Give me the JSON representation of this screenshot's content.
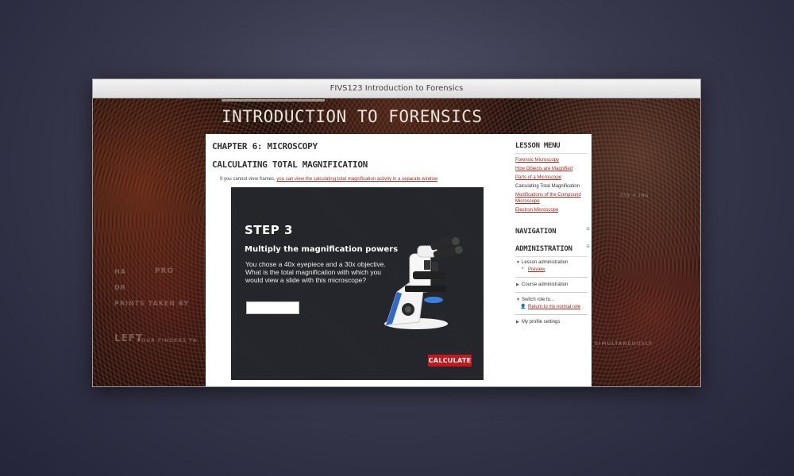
{
  "window": {
    "title": "FIVS123 Introduction to Forensics"
  },
  "banner": {
    "title": "INTRODUCTION TO FORENSICS"
  },
  "background_text": {
    "left_1": "HA",
    "left_2": "PRO",
    "left_3": "DR",
    "left_4": "PRINTS TAKEN BY",
    "left_5": "LEFT",
    "left_6": "FOUR FINGERS TA",
    "right_1": "SIMULTANEOUSLY",
    "right_2": "TTE F ING"
  },
  "main": {
    "chapter_title": "CHAPTER 6: MICROSCOPY",
    "section_title": "CALCULATING TOTAL MAGNIFICATION",
    "frames_note": "If you cannot view frames,",
    "frames_link": "you can view the calculating total magnification activity in a separate window"
  },
  "activity": {
    "step": "STEP 3",
    "title": "Multiply the magnification powers",
    "body": "You chose a 40x eyepiece and a 30x objective. What is the total magnification with which you would view a slide with this microscope?",
    "answer_value": "",
    "calculate_label": "CALCULATE",
    "accent_color": "#c8171b"
  },
  "sidebar": {
    "lesson_menu_title": "LESSON MENU",
    "lesson_items": [
      {
        "label": "Forensic Microscopy",
        "current": false
      },
      {
        "label": "How Objects are Magnified",
        "current": false
      },
      {
        "label": "Parts of a Microscope",
        "current": false
      },
      {
        "label": "Calculating Total Magnification",
        "current": true
      },
      {
        "label": "Modifications of the Compound Microscope",
        "current": false
      },
      {
        "label": "Electron Microscope",
        "current": false
      }
    ],
    "navigation_title": "NAVIGATION",
    "administration_title": "ADMINISTRATION",
    "admin": {
      "lesson_admin": "Lesson administration",
      "preview": "Preview",
      "course_admin": "Course administration",
      "switch_role": "Switch role to...",
      "return_role": "Return to my normal role",
      "profile_settings": "My profile settings"
    }
  }
}
